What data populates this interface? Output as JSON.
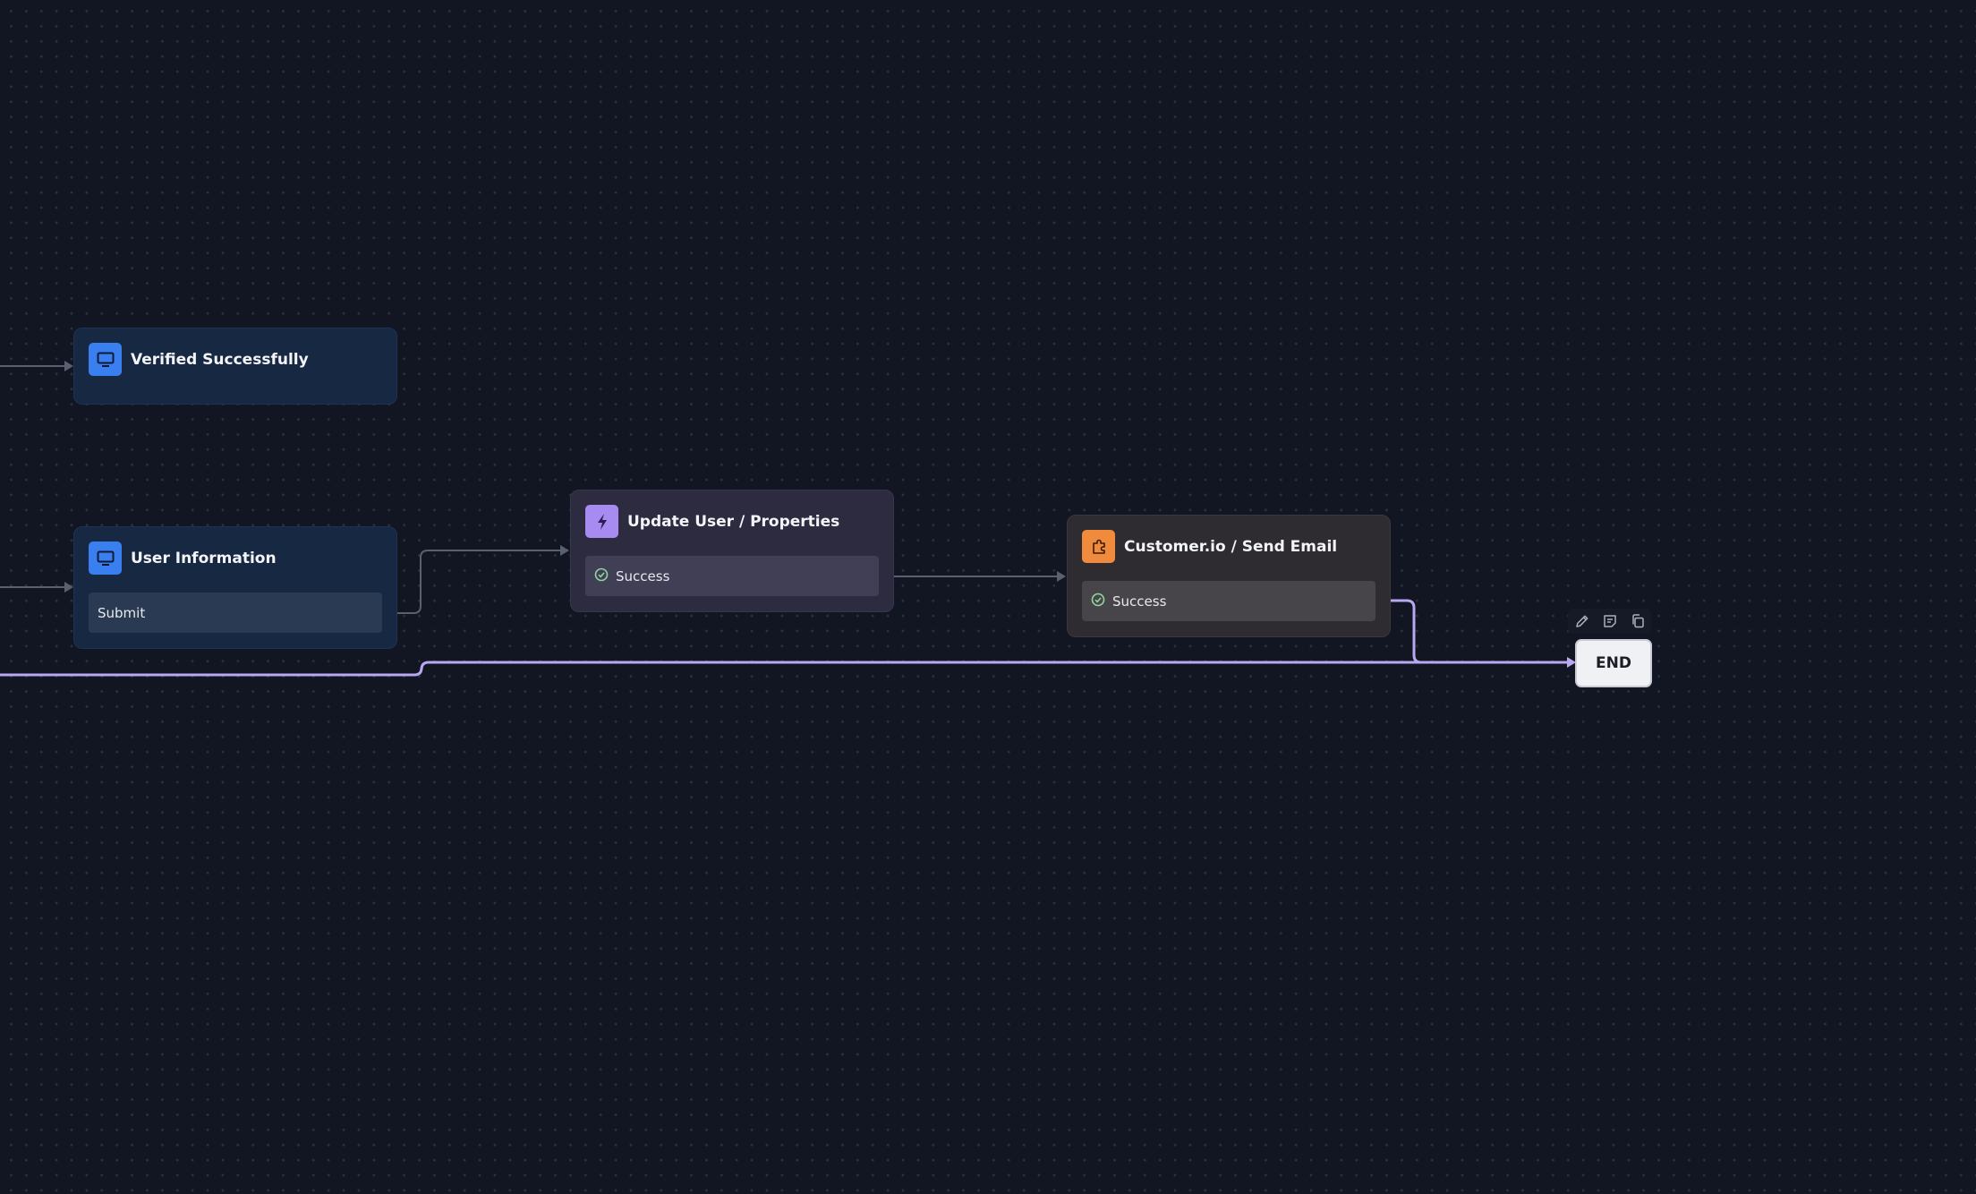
{
  "flow": {
    "nodes": {
      "verified": {
        "title": "Verified Successfully",
        "icon": "monitor-icon",
        "accent": "#3a7ff0"
      },
      "user_information": {
        "title": "User Information",
        "icon": "monitor-icon",
        "accent": "#3a7ff0",
        "port_label": "Submit"
      },
      "update_user": {
        "title": "Update User / Properties",
        "icon": "lightning-icon",
        "accent": "#a78bf0",
        "port_label": "Success",
        "port_icon": "check-circle-icon"
      },
      "customerio": {
        "title": "Customer.io / Send Email",
        "icon": "puzzle-icon",
        "accent": "#f08a3c",
        "port_label": "Success",
        "port_icon": "check-circle-icon"
      },
      "end": {
        "label": "END"
      }
    },
    "end_toolbar": {
      "tools": [
        "pencil-icon",
        "note-icon",
        "copy-icon"
      ]
    },
    "colors": {
      "canvas_bg": "#121622",
      "edge_default": "#5a6070",
      "edge_active": "#b9a7f2"
    }
  }
}
